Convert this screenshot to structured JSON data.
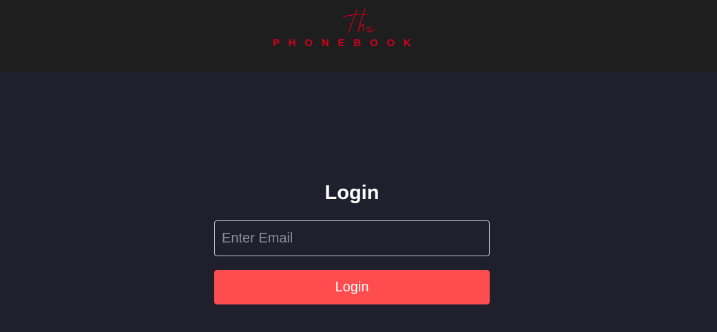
{
  "brand": {
    "script_text": "the",
    "wordmark": "PHONEBOOK",
    "color": "#d0021b"
  },
  "login": {
    "title": "Login",
    "email_placeholder": "Enter Email",
    "button_label": "Login",
    "button_color": "#ff4c4f"
  },
  "colors": {
    "header_bg": "#1e1e1e",
    "page_bg": "#201f2e"
  }
}
